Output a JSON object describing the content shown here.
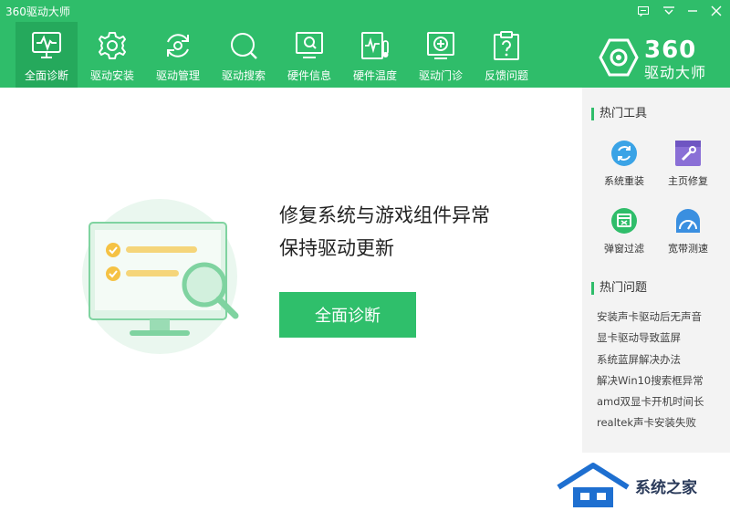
{
  "window": {
    "title": "360驱动大师"
  },
  "toolbar": {
    "tabs": [
      {
        "label": "全面诊断",
        "icon": "monitor-pulse-icon",
        "active": true
      },
      {
        "label": "驱动安装",
        "icon": "gear-icon"
      },
      {
        "label": "驱动管理",
        "icon": "refresh-icon"
      },
      {
        "label": "驱动搜索",
        "icon": "search-icon"
      },
      {
        "label": "硬件信息",
        "icon": "hardware-info-icon"
      },
      {
        "label": "硬件温度",
        "icon": "thermometer-icon"
      },
      {
        "label": "驱动门诊",
        "icon": "clinic-icon"
      },
      {
        "label": "反馈问题",
        "icon": "feedback-icon"
      }
    ]
  },
  "logo": {
    "brand": "360",
    "sub": "驱动大师"
  },
  "main": {
    "headline_line1": "修复系统与游戏组件异常",
    "headline_line2": "保持驱动更新",
    "cta_label": "全面诊断"
  },
  "sidebar": {
    "tools_title": "热门工具",
    "tools": [
      {
        "label": "系统重装",
        "icon": "reinstall-icon"
      },
      {
        "label": "主页修复",
        "icon": "homepage-repair-icon"
      },
      {
        "label": "弹窗过滤",
        "icon": "popup-filter-icon"
      },
      {
        "label": "宽带测速",
        "icon": "speed-test-icon"
      }
    ],
    "questions_title": "热门问题",
    "questions": [
      "安装声卡驱动后无声音",
      "显卡驱动导致蓝屏",
      "系统蓝屏解决办法",
      "解决Win10搜索框异常",
      "amd双显卡开机时间长",
      "realtek声卡安装失败"
    ]
  },
  "watermark": {
    "text": "系统之家"
  },
  "colors": {
    "brand_green": "#2fbd6a",
    "active_tab": "#25a95c",
    "cta": "#2fbf6b",
    "sidebar_bg": "#f3f3f3"
  }
}
